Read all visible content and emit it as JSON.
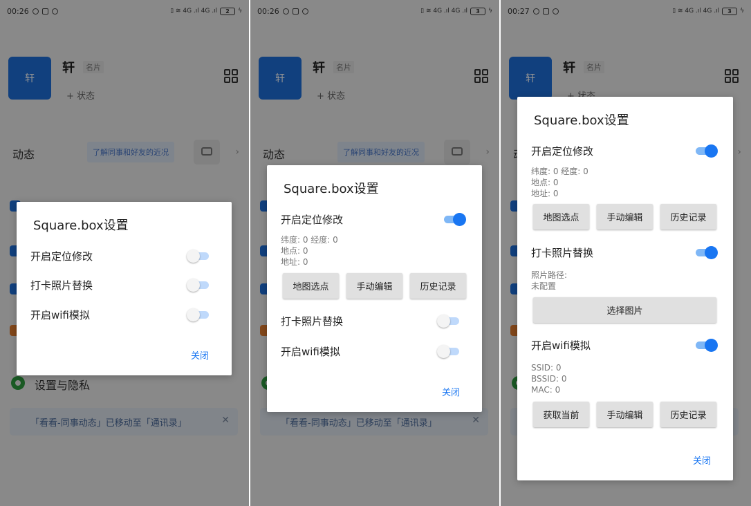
{
  "background": {
    "profile_name": "轩",
    "avatar_text": "轩",
    "card_badge": "名片",
    "status_button": "+ 状态",
    "feed_label": "动态",
    "feed_tip": "了解同事和好友的近况",
    "settings_label": "设置与隐私",
    "notice_text": "「看看-同事动态」已移动至「通讯录」",
    "notice_close": "✕"
  },
  "screens": [
    {
      "status_time": "00:26",
      "battery_level": "2",
      "dialog": {
        "title": "Square.box设置",
        "location_label": "开启定位修改",
        "location_on": false,
        "photo_label": "打卡照片替换",
        "photo_on": false,
        "wifi_label": "开启wifi模拟",
        "wifi_on": false,
        "close_label": "关闭"
      }
    },
    {
      "status_time": "00:26",
      "battery_level": "3",
      "dialog": {
        "title": "Square.box设置",
        "location_label": "开启定位修改",
        "location_on": true,
        "lat_lng": "纬度: 0   经度: 0",
        "place": "地点: 0",
        "address": "地址: 0",
        "btn_map": "地图选点",
        "btn_manual": "手动编辑",
        "btn_history": "历史记录",
        "photo_label": "打卡照片替换",
        "photo_on": false,
        "wifi_label": "开启wifi模拟",
        "wifi_on": false,
        "close_label": "关闭"
      }
    },
    {
      "status_time": "00:27",
      "battery_level": "3",
      "dialog": {
        "title": "Square.box设置",
        "location_label": "开启定位修改",
        "location_on": true,
        "lat_lng": "纬度: 0   经度: 0",
        "place": "地点: 0",
        "address": "地址: 0",
        "btn_map": "地图选点",
        "btn_manual": "手动编辑",
        "btn_history": "历史记录",
        "photo_label": "打卡照片替换",
        "photo_on": true,
        "photo_path_label": "照片路径:",
        "photo_path_value": "未配置",
        "btn_select_image": "选择图片",
        "wifi_label": "开启wifi模拟",
        "wifi_on": true,
        "ssid": "SSID: 0",
        "bssid": "BSSID: 0",
        "mac": "MAC: 0",
        "btn_get_current": "获取当前",
        "btn_wifi_manual": "手动编辑",
        "btn_wifi_history": "历史记录",
        "close_label": "关闭"
      }
    }
  ],
  "colors": {
    "accent": "#1976f2",
    "avatar": "#1e6fd9",
    "switch_track_on": "#7fb7f6",
    "switch_track_off": "#bfd9fb"
  }
}
